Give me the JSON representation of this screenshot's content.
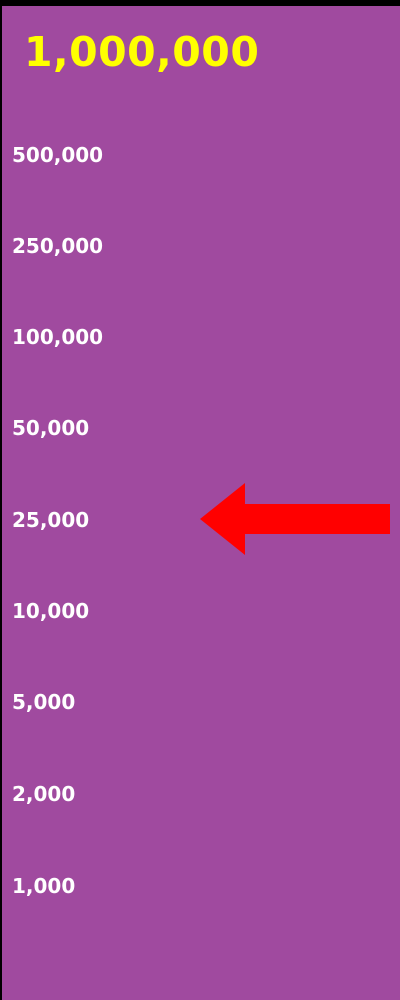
{
  "ladder": {
    "top_prize": "1,000,000",
    "levels": [
      "500,000",
      "250,000",
      "100,000",
      "50,000",
      "25,000",
      "10,000",
      "5,000",
      "2,000",
      "1,000"
    ],
    "current_level": "25,000"
  },
  "colors": {
    "background": "#a04a9f",
    "top_prize_text": "#ffff00",
    "level_text": "#ffffff",
    "arrow": "#ff0000"
  },
  "icons": {
    "pointer": "left-arrow-icon"
  }
}
